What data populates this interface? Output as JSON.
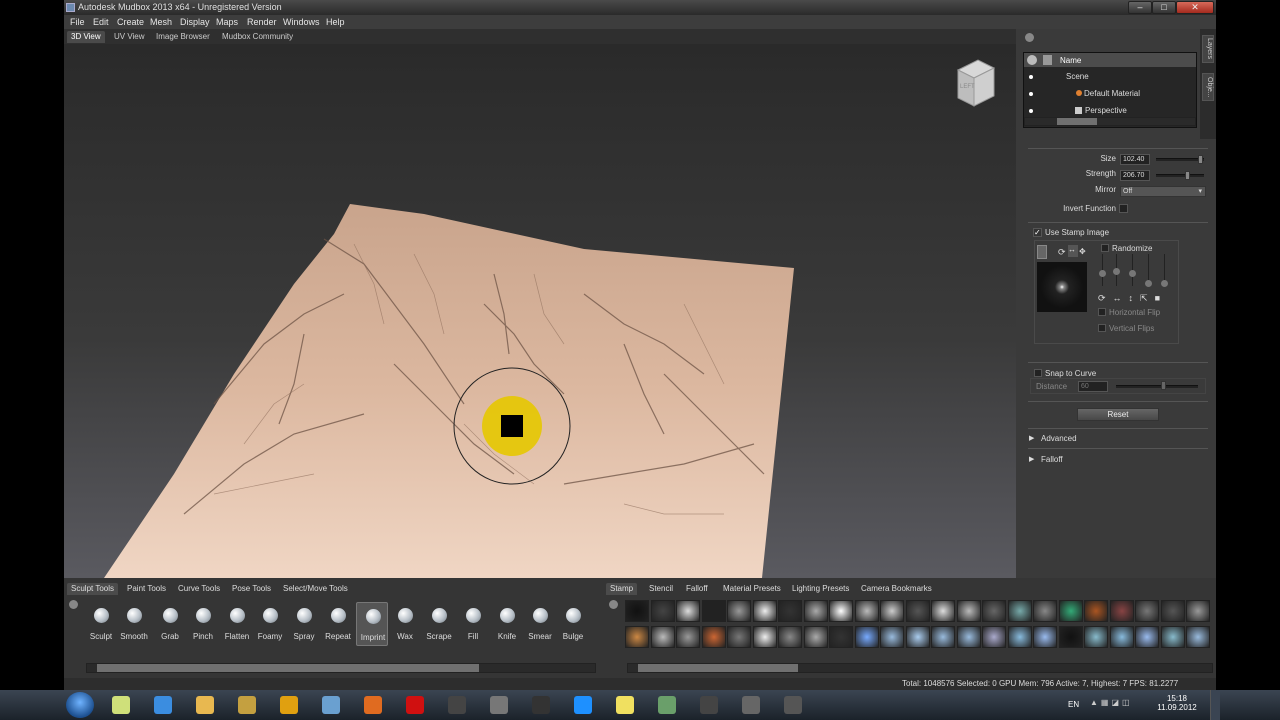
{
  "window": {
    "title": "Autodesk Mudbox 2013 x64  -  Unregistered Version",
    "min": "–",
    "max": "□",
    "close": "✕"
  },
  "menu": [
    "File",
    "Edit",
    "Create",
    "Mesh",
    "Display",
    "Maps",
    "Render",
    "Windows",
    "Help"
  ],
  "view_tabs": [
    "3D View",
    "UV View",
    "Image Browser",
    "Mudbox Community"
  ],
  "viewcube_label": "LEFT",
  "side_tabs": [
    "Layers",
    "Obje..."
  ],
  "outliner": {
    "header": "Name",
    "rows": [
      "Scene",
      "Default Material",
      "Perspective"
    ]
  },
  "props": {
    "size_label": "Size",
    "size_value": "102.40",
    "size_pct": 0.97,
    "strength_label": "Strength",
    "strength_value": "206.70",
    "strength_pct": 0.8,
    "mirror_label": "Mirror",
    "mirror_value": "Off",
    "invert_label": "Invert Function",
    "use_stamp_label": "Use Stamp Image",
    "randomize_label": "Randomize",
    "hflip_label": "Horizontal Flip",
    "vflip_label": "Vertical Flips",
    "snap_label": "Snap to Curve",
    "distance_label": "Distance",
    "distance_value": "60",
    "distance_pct": 0.55,
    "reset_label": "Reset",
    "advanced_label": "Advanced",
    "falloff_label": "Falloff"
  },
  "tool_tabs": [
    "Sculpt Tools",
    "Paint Tools",
    "Curve Tools",
    "Pose Tools",
    "Select/Move Tools"
  ],
  "tools": [
    "Sculpt",
    "Smooth",
    "Grab",
    "Pinch",
    "Flatten",
    "Foamy",
    "Spray",
    "Repeat",
    "Imprint",
    "Wax",
    "Scrape",
    "Fill",
    "Knife",
    "Smear",
    "Bulge"
  ],
  "selected_tool": "Imprint",
  "stamp_tabs": [
    "Stamp",
    "Stencil",
    "Falloff",
    "Material Presets",
    "Lighting Presets",
    "Camera Bookmarks"
  ],
  "status": "Total: 1048576  Selected: 0 GPU Mem: 796  Active: 7, Highest: 7  FPS: 81.2277",
  "taskbar": {
    "lang": "EN",
    "time": "15:18",
    "date": "11.09.2012",
    "icons": [
      "explorer",
      "internet-explorer",
      "folder",
      "media-player",
      "avast",
      "app",
      "firefox",
      "opera",
      "steam",
      "pixelmator",
      "udk",
      "skype",
      "sticky-notes",
      "image",
      "udk",
      "mudbox",
      "app"
    ]
  },
  "colors": {
    "terrain": "#d7b29a",
    "brush": "#e6c800",
    "accent": "#4c4c4c"
  }
}
